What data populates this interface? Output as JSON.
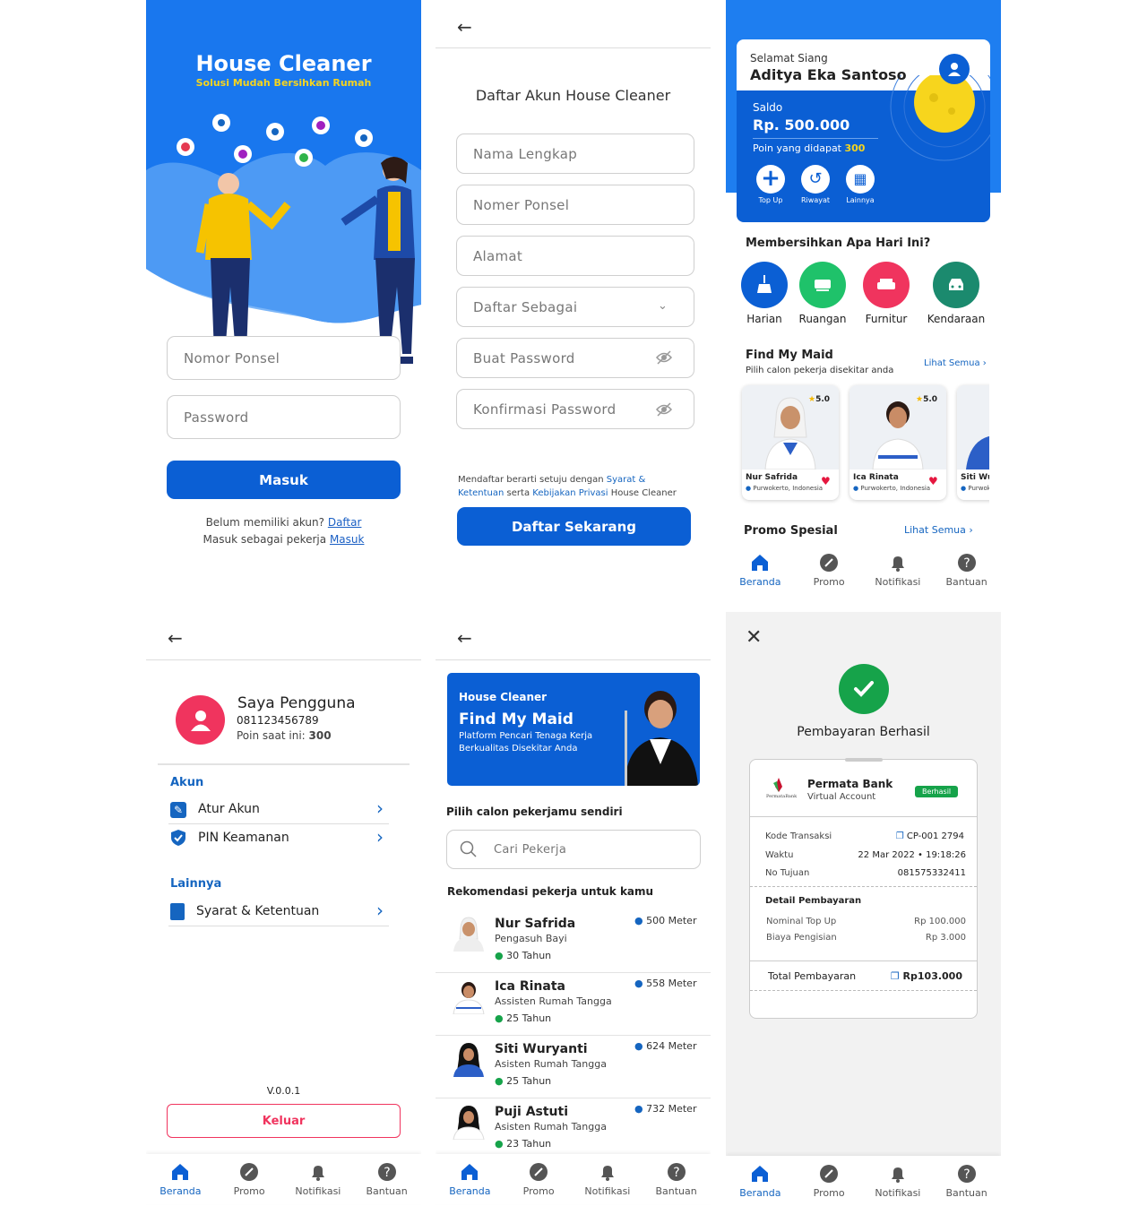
{
  "s1": {
    "title": "House Cleaner",
    "subtitle": "Solusi Mudah Bersihkan Rumah",
    "phone_placeholder": "Nomor Ponsel",
    "password_placeholder": "Password",
    "login_label": "Masuk",
    "no_account": "Belum memiliki akun?",
    "register_link": "Daftar",
    "as_worker": "Masuk sebagai pekerja",
    "login_link": "Masuk"
  },
  "s2": {
    "heading": "Daftar Akun House Cleaner",
    "fields": [
      "Nama Lengkap",
      "Nomer Ponsel",
      "Alamat",
      "Daftar Sebagai",
      "Buat Password",
      "Konfirmasi Password"
    ],
    "terms_pre": "Mendaftar berarti setuju dengan",
    "terms_link1": "Syarat & Ketentuan",
    "terms_mid": "serta",
    "terms_link2": "Kebijakan Privasi",
    "terms_post": "House Cleaner",
    "submit_label": "Daftar Sekarang"
  },
  "s3": {
    "greeting": "Selamat Siang",
    "user_name": "Aditya Eka Santoso",
    "saldo_label": "Saldo",
    "saldo_value": "Rp. 500.000",
    "points_label": "Poin yang didapat",
    "points_value": "300",
    "actions": [
      "Top Up",
      "Riwayat",
      "Lainnya"
    ],
    "section_title": "Membersihkan Apa Hari Ini?",
    "categories": [
      "Harian",
      "Ruangan",
      "Furnitur",
      "Kendaraan"
    ],
    "find_title": "Find My Maid",
    "find_sub": "Pilih calon pekerja disekitar anda",
    "see_all": "Lihat Semua",
    "maids": [
      {
        "name": "Nur Safrida",
        "loc": "Purwokerto, Indonesia",
        "rating": "5.0"
      },
      {
        "name": "Ica Rinata",
        "loc": "Purwokerto, Indonesia",
        "rating": "5.0"
      },
      {
        "name": "Siti Wu",
        "loc": "Purwoke",
        "rating": ""
      }
    ],
    "promo_title": "Promo Spesial",
    "promo_see_all": "Lihat Semua"
  },
  "nav": [
    "Beranda",
    "Promo",
    "Notifikasi",
    "Bantuan"
  ],
  "s4": {
    "name": "Saya Pengguna",
    "phone": "081123456789",
    "points_label": "Poin saat ini:",
    "points_value": "300",
    "akun_title": "Akun",
    "akun_items": [
      "Atur Akun",
      "PIN Keamanan"
    ],
    "lainnya_title": "Lainnya",
    "lainnya_items": [
      "Syarat & Ketentuan"
    ],
    "version": "V.0.0.1",
    "logout_label": "Keluar"
  },
  "s5": {
    "banner_brand": "House Cleaner",
    "banner_title": "Find My Maid",
    "banner_sub": "Platform Pencari Tenaga Kerja Berkualitas Disekitar Anda",
    "pick_title": "Pilih calon pekerjamu sendiri",
    "search_placeholder": "Cari Pekerja",
    "rec_title": "Rekomendasi pekerja untuk kamu",
    "workers": [
      {
        "name": "Nur Safrida",
        "role": "Pengasuh Bayi",
        "age": "30 Tahun",
        "dist": "500 Meter"
      },
      {
        "name": "Ica Rinata",
        "role": "Assisten Rumah Tangga",
        "age": "25 Tahun",
        "dist": "558 Meter"
      },
      {
        "name": "Siti Wuryanti",
        "role": "Asisten Rumah Tangga",
        "age": "25 Tahun",
        "dist": "624 Meter"
      },
      {
        "name": "Puji Astuti",
        "role": "Asisten Rumah Tangga",
        "age": "23 Tahun",
        "dist": "732 Meter"
      }
    ]
  },
  "s6": {
    "status_title": "Pembayaran Berhasil",
    "bank_logo_text": "PermataBank",
    "bank_name": "Permata Bank",
    "bank_type": "Virtual Account",
    "badge": "Berhasil",
    "kode_label": "Kode Transaksi",
    "kode_value": "CP-001 2794",
    "waktu_label": "Waktu",
    "waktu_value": "22 Mar 2022 • 19:18:26",
    "tujuan_label": "No Tujuan",
    "tujuan_value": "081575332411",
    "detail_title": "Detail Pembayaran",
    "nominal_label": "Nominal Top Up",
    "nominal_value": "Rp 100.000",
    "biaya_label": "Biaya Pengisian",
    "biaya_value": "Rp 3.000",
    "total_label": "Total Pembayaran",
    "total_value": "Rp103.000"
  },
  "colors": {
    "primary": "#0b5fd4",
    "sky": "#1e7ef0",
    "green": "#16a34a",
    "pink": "#f0345e"
  }
}
